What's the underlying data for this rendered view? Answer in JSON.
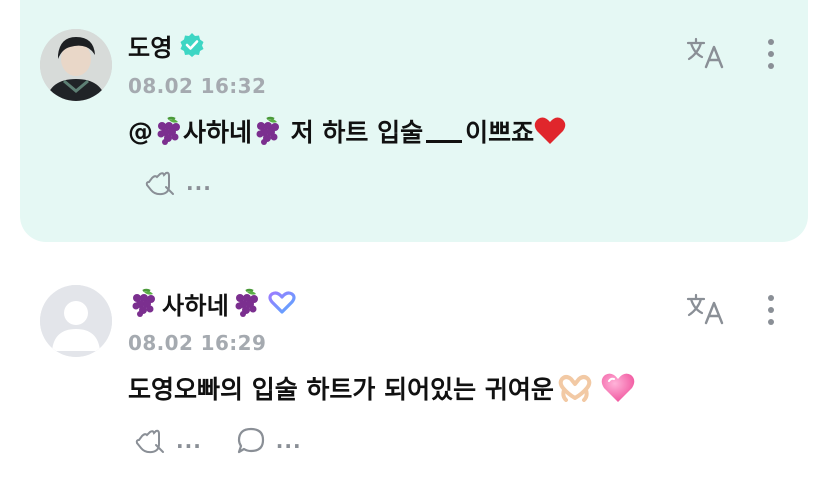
{
  "comments": [
    {
      "author": "도영",
      "verified": true,
      "timestamp": "08.02 16:32",
      "mention": "@",
      "mention_name": "사하네",
      "text": " 저 하트 입술",
      "text_tail": "이쁘죠",
      "highlighted": true,
      "avatar_icon": "profile-photo",
      "actions": {
        "react_icon": "reaction-add-icon",
        "more_label": "..."
      }
    },
    {
      "author": "사하네",
      "verified": false,
      "timestamp": "08.02 16:29",
      "text": "도영오빠의 입술 하트가 되어있는 귀여운",
      "highlighted": false,
      "avatar_icon": "default-avatar-icon",
      "actions": {
        "react_icon": "reaction-add-icon",
        "more_label": "...",
        "reply_icon": "reply-bubble-icon",
        "reply_more_label": "..."
      }
    }
  ],
  "colors": {
    "highlight_bg": "#e5f8f4",
    "verified_badge": "#3dd6c4",
    "membership_badge": "#7b8cff",
    "timestamp": "#a5aab0",
    "icon_gray": "#8a8f96"
  }
}
